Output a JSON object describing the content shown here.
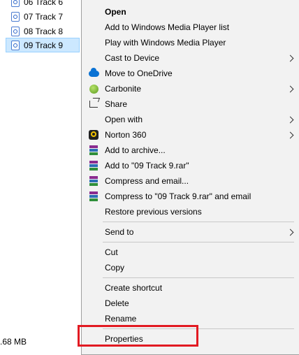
{
  "explorer": {
    "files": [
      {
        "name": "06 Track 6",
        "selected": false
      },
      {
        "name": "07 Track 7",
        "selected": false
      },
      {
        "name": "08 Track 8",
        "selected": false
      },
      {
        "name": "09 Track 9",
        "selected": true
      }
    ],
    "status_size": ".68 MB"
  },
  "context_menu": {
    "items": [
      {
        "label": "Open",
        "bold": true,
        "icon": null,
        "submenu": false
      },
      {
        "label": "Add to Windows Media Player list",
        "icon": null,
        "submenu": false
      },
      {
        "label": "Play with Windows Media Player",
        "icon": null,
        "submenu": false
      },
      {
        "label": "Cast to Device",
        "icon": null,
        "submenu": true
      },
      {
        "label": "Move to OneDrive",
        "icon": "onedrive-cloud-icon",
        "submenu": false
      },
      {
        "label": "Carbonite",
        "icon": "carbonite-icon",
        "submenu": true
      },
      {
        "label": "Share",
        "icon": "share-icon",
        "submenu": false
      },
      {
        "label": "Open with",
        "icon": null,
        "submenu": true
      },
      {
        "label": "Norton 360",
        "icon": "norton-icon",
        "submenu": true
      },
      {
        "label": "Add to archive...",
        "icon": "winrar-icon",
        "submenu": false
      },
      {
        "label": "Add to \"09 Track 9.rar\"",
        "icon": "winrar-icon",
        "submenu": false
      },
      {
        "label": "Compress and email...",
        "icon": "winrar-icon",
        "submenu": false
      },
      {
        "label": "Compress to \"09 Track 9.rar\" and email",
        "icon": "winrar-icon",
        "submenu": false
      },
      {
        "label": "Restore previous versions",
        "icon": null,
        "submenu": false
      },
      {
        "label": "Send to",
        "icon": null,
        "submenu": true
      },
      {
        "label": "Cut",
        "icon": null,
        "submenu": false
      },
      {
        "label": "Copy",
        "icon": null,
        "submenu": false
      },
      {
        "label": "Create shortcut",
        "icon": null,
        "submenu": false
      },
      {
        "label": "Delete",
        "icon": null,
        "submenu": false
      },
      {
        "label": "Rename",
        "icon": null,
        "submenu": false
      },
      {
        "label": "Properties",
        "icon": null,
        "submenu": false
      }
    ]
  },
  "colors": {
    "menu_background": "#f2f2f2",
    "selection_background": "#cce8ff",
    "highlight_box": "#e21a22"
  }
}
